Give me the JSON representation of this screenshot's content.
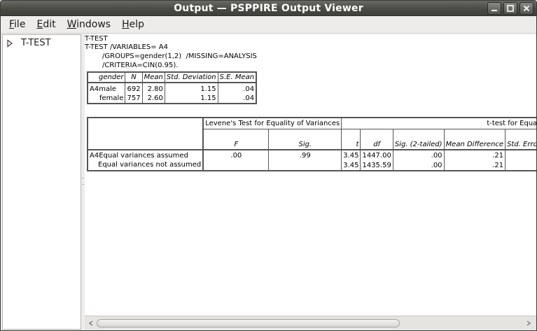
{
  "window": {
    "title": "Output — PSPPIRE Output Viewer"
  },
  "menu": {
    "items": [
      {
        "label_first": "F",
        "label_rest": "ile"
      },
      {
        "label_first": "E",
        "label_rest": "dit"
      },
      {
        "label_first": "W",
        "label_rest": "indows"
      },
      {
        "label_first": "H",
        "label_rest": "elp"
      }
    ]
  },
  "tree": {
    "item_label": "T-TEST"
  },
  "syntax": {
    "line1": "T-TEST",
    "line2": "T-TEST /VARIABLES= A4",
    "line3": "/GROUPS=gender(1,2)  /MISSING=ANALYSIS",
    "line4": "/CRITERIA=CIN(0.95)."
  },
  "group_stats": {
    "headers": [
      "gender",
      "N",
      "Mean",
      "Std. Deviation",
      "S.E. Mean"
    ],
    "var_label": "A4",
    "rows": [
      {
        "group": "male",
        "n": "692",
        "mean": "2.80",
        "sd": "1.15",
        "se": ".04"
      },
      {
        "group": "female",
        "n": "757",
        "mean": "2.60",
        "sd": "1.15",
        "se": ".04"
      }
    ]
  },
  "ttest": {
    "levene_header": "Levene's Test for Equality of Variances",
    "ttest_header": "t-test for Equality",
    "col_headers": [
      "F",
      "Sig.",
      "t",
      "df",
      "Sig. (2-tailed)",
      "Mean Difference",
      "Std. Error D"
    ],
    "var_label": "A4",
    "rows": [
      {
        "label": "Equal variances assumed",
        "f": ".00",
        "sig": ".99",
        "t": "3.45",
        "df": "1447.00",
        "sig2": ".00",
        "md": ".21"
      },
      {
        "label": "Equal variances not assumed",
        "f": "",
        "sig": "",
        "t": "3.45",
        "df": "1435.59",
        "sig2": ".00",
        "md": ".21"
      }
    ]
  },
  "colors": {
    "titlebar": "#4b4b46",
    "background": "#edeceb",
    "table_border": "#555555"
  }
}
